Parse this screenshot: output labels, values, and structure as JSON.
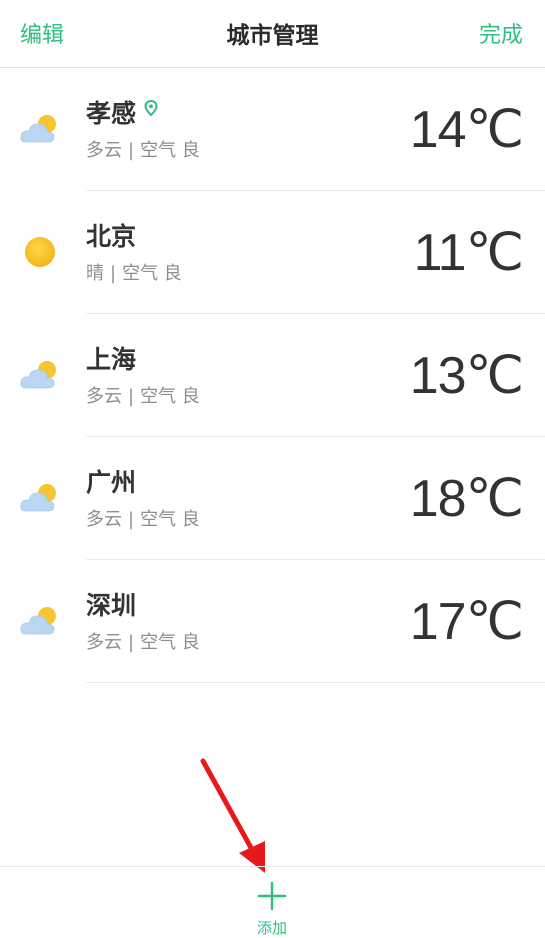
{
  "header": {
    "left_action": "编辑",
    "title": "城市管理",
    "right_action": "完成"
  },
  "cities": [
    {
      "name": "孝感",
      "weather": "多云",
      "separator": "|",
      "air": "空气 良",
      "temp": "14℃",
      "icon": "partly-cloudy-icon",
      "is_current_location": true
    },
    {
      "name": "北京",
      "weather": "晴",
      "separator": "|",
      "air": "空气 良",
      "temp": "11℃",
      "icon": "sunny-icon",
      "is_current_location": false
    },
    {
      "name": "上海",
      "weather": "多云",
      "separator": "|",
      "air": "空气 良",
      "temp": "13℃",
      "icon": "partly-cloudy-icon",
      "is_current_location": false
    },
    {
      "name": "广州",
      "weather": "多云",
      "separator": "|",
      "air": "空气 良",
      "temp": "18℃",
      "icon": "partly-cloudy-icon",
      "is_current_location": false
    },
    {
      "name": "深圳",
      "weather": "多云",
      "separator": "|",
      "air": "空气 良",
      "temp": "17℃",
      "icon": "partly-cloudy-icon",
      "is_current_location": false
    }
  ],
  "bottom": {
    "add_label": "添加",
    "add_icon": "plus-icon"
  },
  "colors": {
    "accent": "#2fbf7f",
    "text_primary": "#333333",
    "text_secondary": "#8e8e8e",
    "annotation": "#e8191c"
  }
}
